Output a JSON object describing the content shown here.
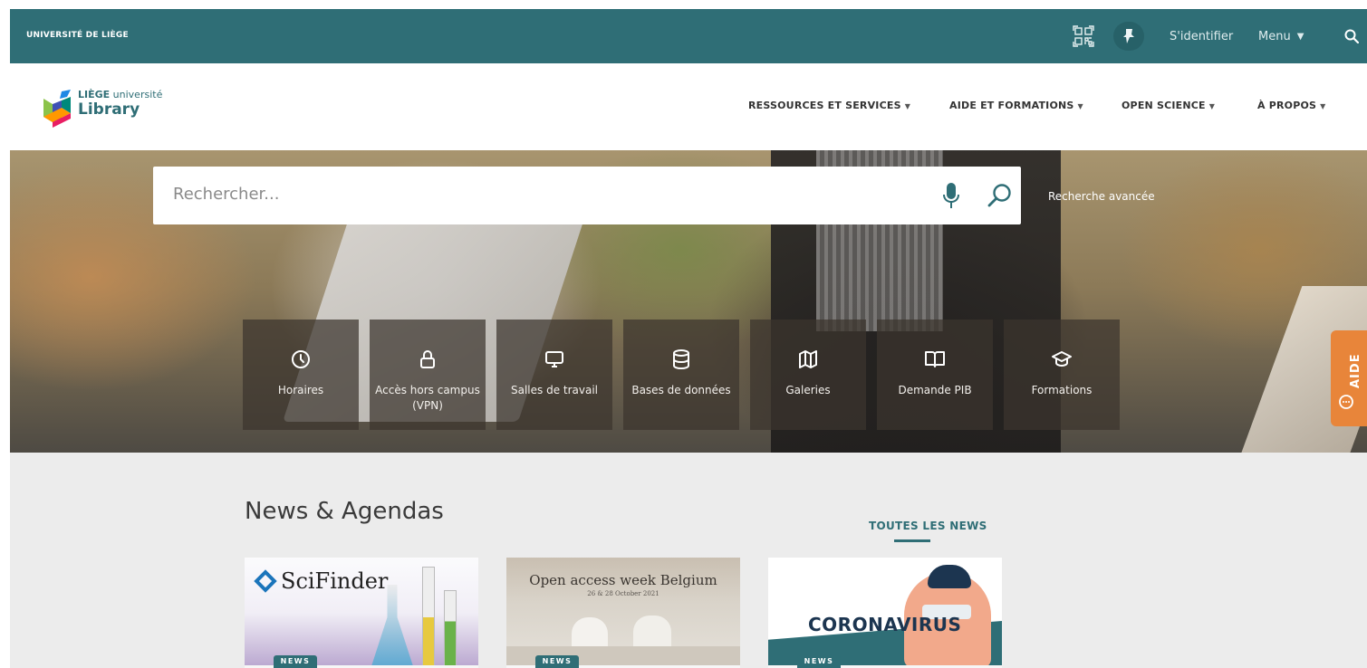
{
  "topbar": {
    "brand": "UNIVERSITÉ DE LIÈGE",
    "signin": "S'identifier",
    "menu": "Menu"
  },
  "logo": {
    "line1_bold": "LIÈGE",
    "line1_rest": " université",
    "line2": "Library"
  },
  "nav": [
    {
      "label": "RESSOURCES ET SERVICES"
    },
    {
      "label": "AIDE ET FORMATIONS"
    },
    {
      "label": "OPEN SCIENCE"
    },
    {
      "label": "À PROPOS"
    }
  ],
  "search": {
    "placeholder": "Rechercher...",
    "advanced": "Recherche avancée"
  },
  "tiles": [
    {
      "label": "Horaires",
      "icon": "clock-icon"
    },
    {
      "label": "Accès hors campus (VPN)",
      "icon": "lock-icon"
    },
    {
      "label": "Salles de travail",
      "icon": "monitor-icon"
    },
    {
      "label": "Bases de données",
      "icon": "database-icon"
    },
    {
      "label": "Galeries",
      "icon": "map-icon"
    },
    {
      "label": "Demande PIB",
      "icon": "book-open-icon"
    },
    {
      "label": "Formations",
      "icon": "graduation-cap-icon"
    }
  ],
  "aide": "AIDE",
  "news": {
    "title": "News & Agendas",
    "all": "TOUTES LES NEWS",
    "cards": [
      {
        "image_text": "SciFinder",
        "badge": "NEWS"
      },
      {
        "image_text": "Open access week Belgium",
        "image_subtext": "26 & 28 October 2021",
        "badge": "NEWS"
      },
      {
        "image_text": "CORONAVIRUS",
        "badge": "NEWS"
      }
    ]
  },
  "colors": {
    "brand_teal": "#2f6e76",
    "aide_orange": "#e8853a"
  }
}
